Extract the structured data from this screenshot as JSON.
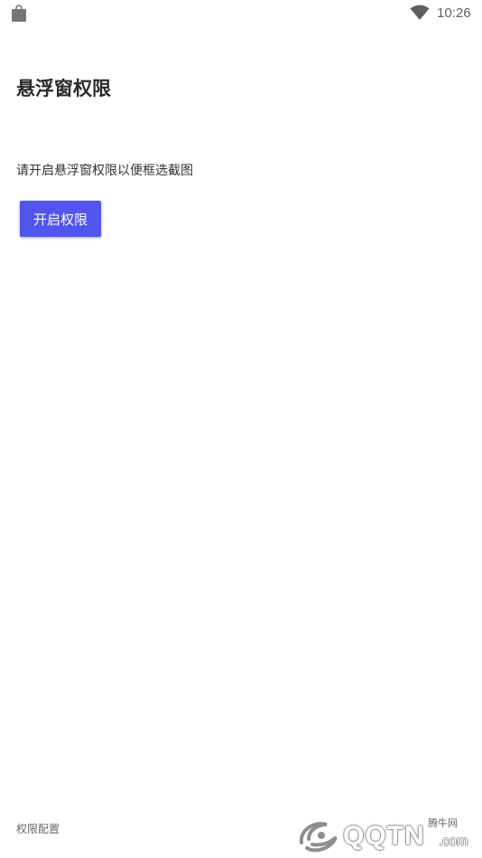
{
  "status_bar": {
    "time": "10:26",
    "left_icon": "shopping-bag-icon",
    "right_icon": "wifi-icon"
  },
  "page": {
    "title": "悬浮窗权限",
    "description": "请开启悬浮窗权限以便框选截图",
    "enable_button_label": "开启权限",
    "footer_link": "权限配置"
  },
  "watermark": {
    "brand": "QQTN",
    "domain": ".com",
    "chinese": "腾牛网"
  },
  "colors": {
    "background": "#ffffff",
    "button": "#5254ee",
    "title_text": "#2b2b2b",
    "status_icons": "#5f5f5f"
  }
}
